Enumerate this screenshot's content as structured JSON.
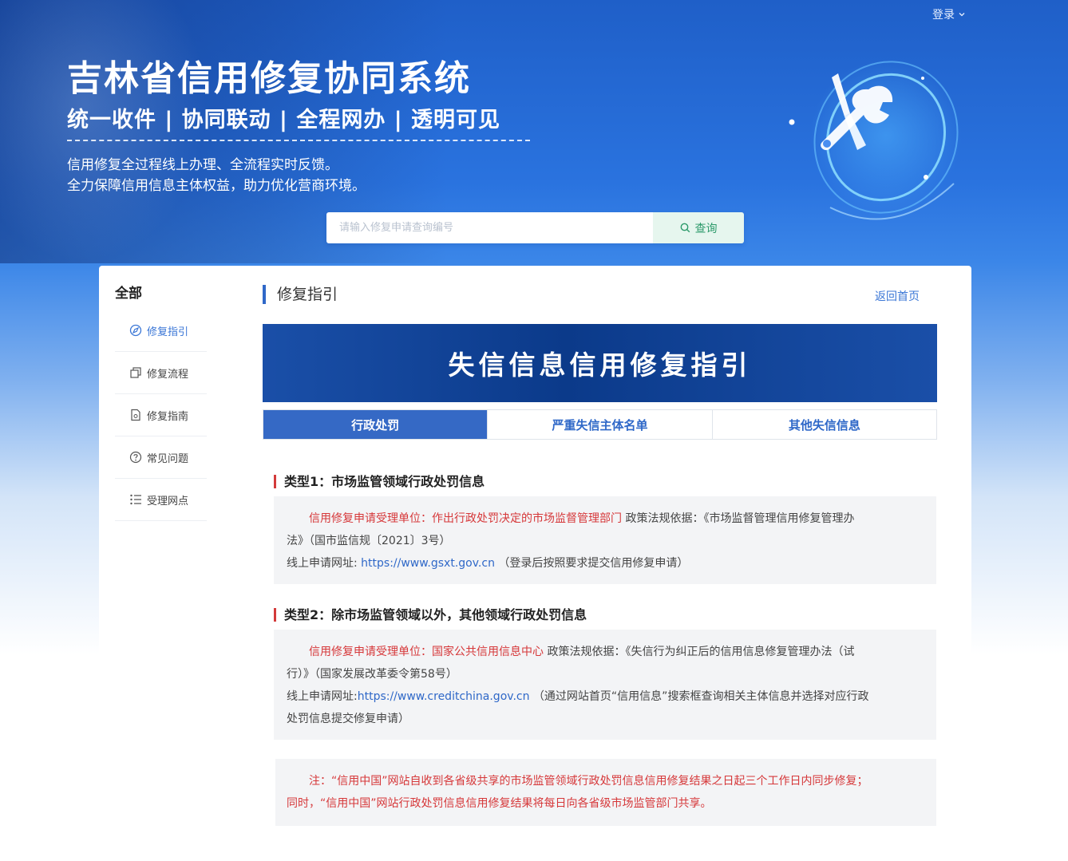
{
  "header": {
    "login_label": "登录",
    "title": "吉林省信用修复协同系统",
    "slogan": "统一收件 | 协同联动 | 全程网办 | 透明可见",
    "desc_line1": "信用修复全过程线上办理、全流程实时反馈。",
    "desc_line2": "全力保障信用信息主体权益，助力优化营商环境。"
  },
  "search": {
    "placeholder": "请输入修复申请查询编号",
    "button_label": "查询"
  },
  "sidebar": {
    "title": "全部",
    "items": [
      {
        "label": "修复指引",
        "icon": "compass-icon",
        "active": true
      },
      {
        "label": "修复流程",
        "icon": "copy-icon",
        "active": false
      },
      {
        "label": "修复指南",
        "icon": "document-icon",
        "active": false
      },
      {
        "label": "常见问题",
        "icon": "question-icon",
        "active": false
      },
      {
        "label": "受理网点",
        "icon": "list-icon",
        "active": false
      }
    ]
  },
  "content": {
    "section_title": "修复指引",
    "back_home": "返回首页",
    "banner_title": "失信信息信用修复指引",
    "tabs": [
      {
        "label": "行政处罚",
        "active": true
      },
      {
        "label": "严重失信主体名单",
        "active": false
      },
      {
        "label": "其他失信信息",
        "active": false
      }
    ],
    "type1": {
      "heading": "类型1：市场监管领域行政处罚信息",
      "unit_label": "信用修复申请受理单位：作出行政处罚决定的市场监督管理部门",
      "policy_a": " 政策法规依据：《市场监督管理信用修复管理办",
      "policy_b": "法》（国市监信规〔2021〕3号）",
      "online_label": "线上申请网址: ",
      "online_url": "https://www.gsxt.gov.cn",
      "online_note": " （登录后按照要求提交信用修复申请）"
    },
    "type2": {
      "heading": "类型2：除市场监管领域以外，其他领域行政处罚信息",
      "unit_label": "信用修复申请受理单位：国家公共信用信息中心",
      "policy_a": " 政策法规依据：《失信行为纠正后的信用信息修复管理办法（试",
      "policy_b": "行）》（国家发展改革委令第58号）",
      "online_label": "线上申请网址:",
      "online_url": "https://www.creditchina.gov.cn",
      "online_note_a": " （通过网站首页“信用信息”搜索框查询相关主体信息并选择对应行政",
      "online_note_b": "处罚信息提交修复申请）"
    },
    "note": {
      "line1": "注：“信用中国”网站自收到各省级共享的市场监管领域行政处罚信息信用修复结果之日起三个工作日内同步修复；",
      "line2": "同时，“信用中国”网站行政处罚信息信用修复结果将每日向各省级市场监管部门共享。"
    }
  },
  "colors": {
    "primary": "#2f68c8",
    "accent_red": "#d6383a",
    "banner": "#0b3a8a"
  }
}
